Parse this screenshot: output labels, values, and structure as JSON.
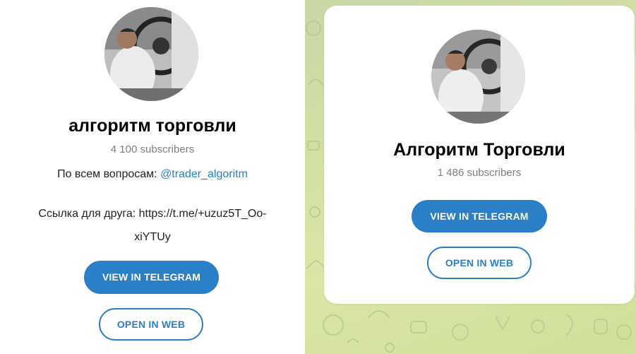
{
  "left": {
    "title": "алгоритм торговли",
    "subscribers": "4 100 subscribers",
    "desc_prefix": "По всем вопросам: ",
    "desc_link": "@trader_algoritm",
    "friend_line1": "Ссылка для друга: https://t.me/+uzuz5T_Oo-",
    "friend_line2": "xiYTUy",
    "view_button": "VIEW IN TELEGRAM",
    "web_button": "OPEN IN WEB"
  },
  "right": {
    "title": "Алгоритм Торговли",
    "subscribers": "1 486 subscribers",
    "view_button": "VIEW IN TELEGRAM",
    "web_button": "OPEN IN WEB"
  },
  "colors": {
    "accent": "#2a7fc7",
    "link": "#2481cc",
    "muted": "#7f7f7f",
    "background_pattern": "#d3e0a4"
  },
  "icons": {
    "avatar": "channel-avatar-photo"
  }
}
